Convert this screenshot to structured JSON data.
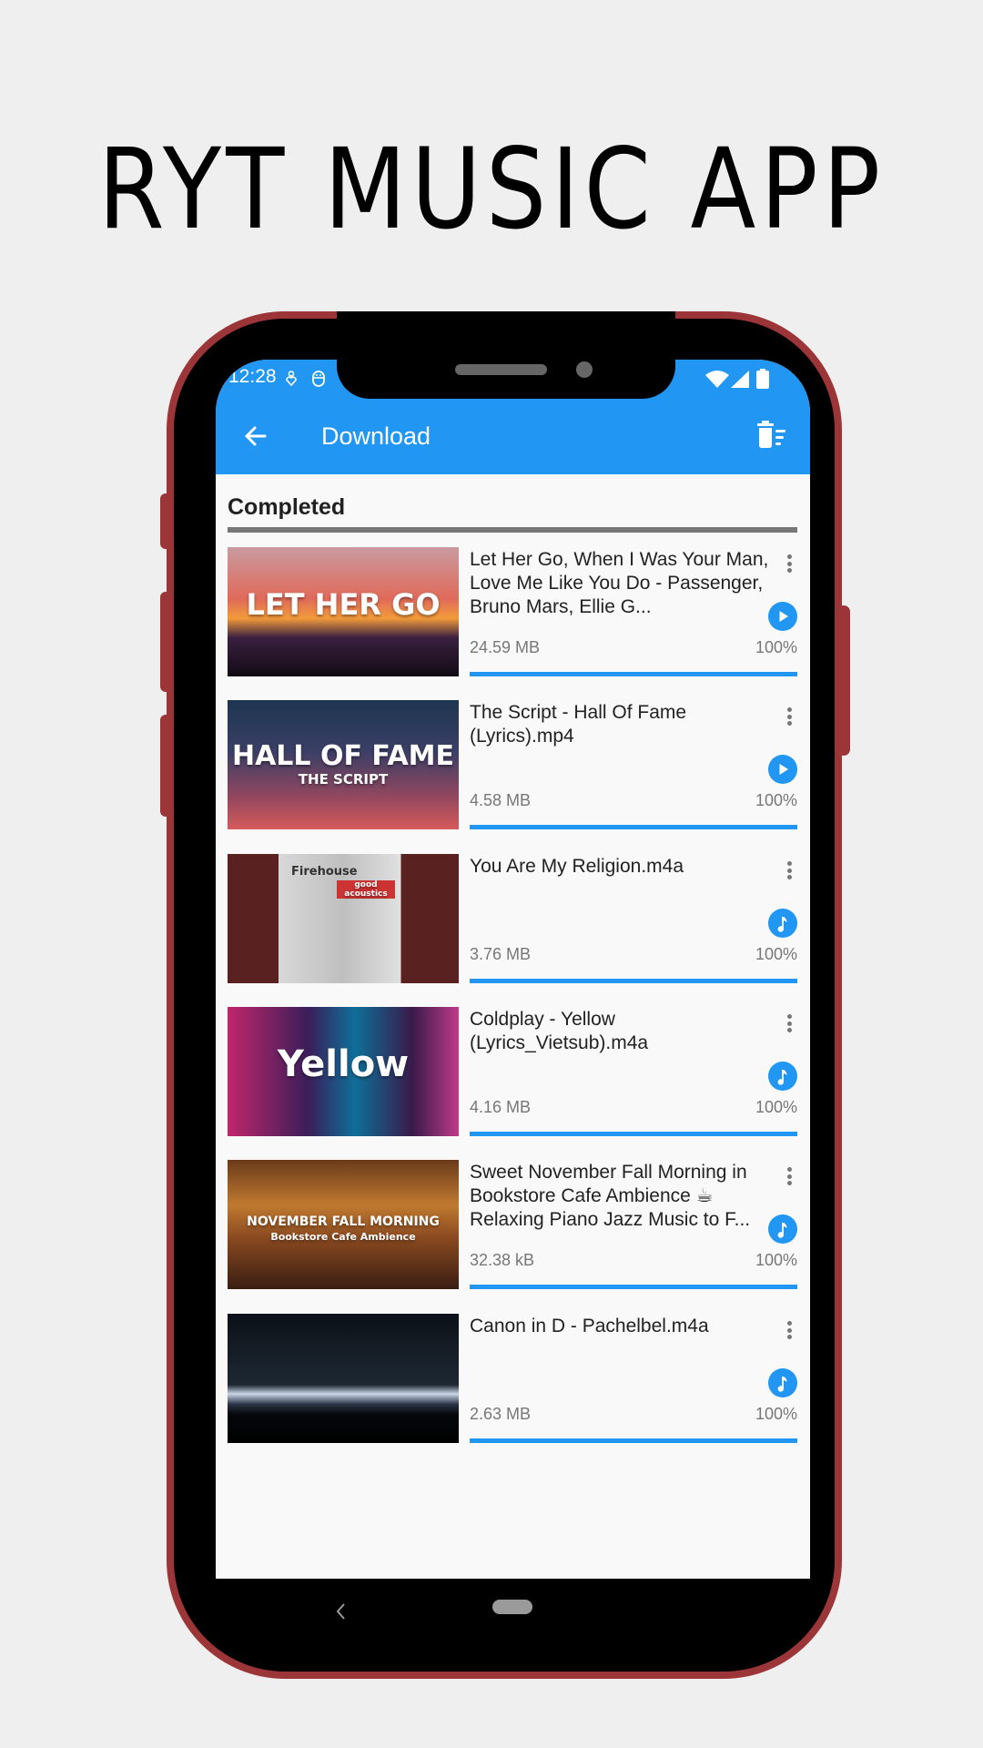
{
  "promo": {
    "title": "RYT MUSIC APP"
  },
  "status_bar": {
    "time": "12:28",
    "left_icons": [
      "notification-icon",
      "assistant-icon"
    ],
    "right_icons": [
      "wifi-icon",
      "signal-icon",
      "battery-icon"
    ]
  },
  "app_bar": {
    "title": "Download",
    "back_icon": "arrow-back-icon",
    "action_icon": "delete-sweep-icon",
    "color": "#2196f3"
  },
  "section": {
    "label": "Completed"
  },
  "downloads": [
    {
      "title": "Let Her Go, When I Was Your Man, Love Me Like You Do - Passenger, Bruno Mars, Ellie G...",
      "size": "24.59 MB",
      "percent_label": "100%",
      "progress": 100,
      "action": "play",
      "thumb_text": "LET HER GO",
      "thumb_subtext": ""
    },
    {
      "title": "The Script - Hall Of Fame (Lyrics).mp4",
      "size": "4.58 MB",
      "percent_label": "100%",
      "progress": 100,
      "action": "play",
      "thumb_text": "HALL OF FAME",
      "thumb_subtext": "THE SCRIPT"
    },
    {
      "title": "You Are My Religion.m4a",
      "size": "3.76 MB",
      "percent_label": "100%",
      "progress": 100,
      "action": "music",
      "thumb_text": "Firehouse",
      "thumb_subtext": "good acoustics"
    },
    {
      "title": "Coldplay - Yellow (Lyrics_Vietsub).m4a",
      "size": "4.16 MB",
      "percent_label": "100%",
      "progress": 100,
      "action": "music",
      "thumb_text": "Yellow",
      "thumb_subtext": ""
    },
    {
      "title": "Sweet November Fall Morning in Bookstore Cafe Ambience ☕ Relaxing Piano Jazz Music to F...",
      "size": "32.38 kB",
      "percent_label": "100%",
      "progress": 100,
      "action": "music",
      "thumb_text": "NOVEMBER FALL MORNING",
      "thumb_subtext": "Bookstore Cafe Ambience"
    },
    {
      "title": "Canon in D - Pachelbel.m4a",
      "size": "2.63 MB",
      "percent_label": "100%",
      "progress": 100,
      "action": "music",
      "thumb_text": "",
      "thumb_subtext": ""
    }
  ],
  "nav_bar": {
    "back": "nav-back-icon",
    "home": "nav-home-pill"
  }
}
